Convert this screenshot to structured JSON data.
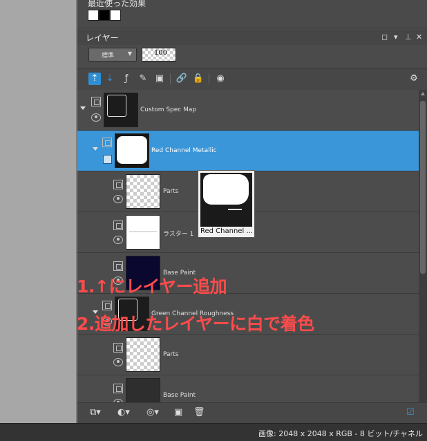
{
  "recent": {
    "label": "最近使った効果"
  },
  "panel": {
    "title": "レイヤー",
    "blend_mode": "標準",
    "opacity": "100"
  },
  "layers": [
    {
      "name": "Custom Spec Map"
    },
    {
      "name": "Red Channel Metallic"
    },
    {
      "name": "Parts"
    },
    {
      "name": "ラスター 1"
    },
    {
      "name": "Base Paint"
    },
    {
      "name": "Green Channel Roughness"
    },
    {
      "name": "Parts"
    },
    {
      "name": "Base Paint"
    }
  ],
  "tooltip": {
    "label": "Red Channel ..."
  },
  "overlay": {
    "line1": "1.↑にレイヤー追加",
    "line2": "2.追加したレイヤーに白で着色"
  },
  "status": {
    "text": "画像:  2048 x 2048 x RGB - 8 ビット/チャネル"
  },
  "colors": {
    "selection": "#3a96d8",
    "annotation": "#ff4b4b"
  }
}
